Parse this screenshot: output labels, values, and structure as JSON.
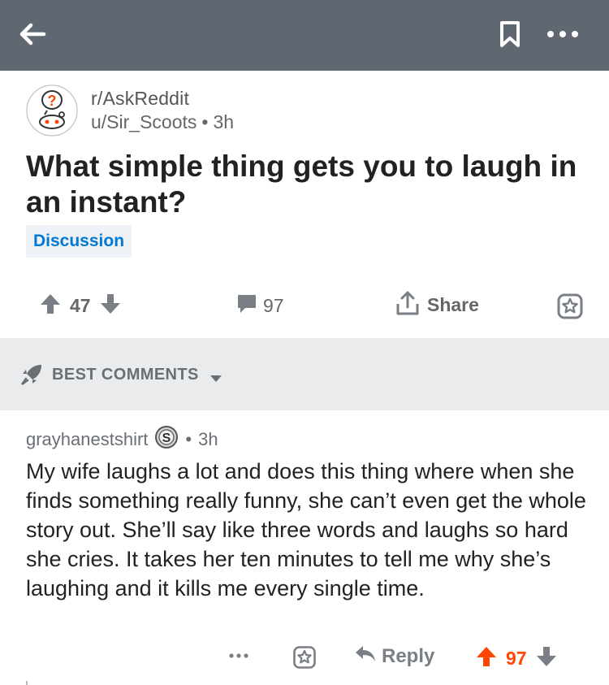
{
  "topbar": {
    "back_icon": "arrow-left-icon",
    "bookmark_icon": "bookmark-icon",
    "more_icon": "more-horizontal-icon",
    "color": "#5f6770"
  },
  "post": {
    "subreddit": "r/AskReddit",
    "author": "u/Sir_Scoots",
    "separator": "•",
    "age": "3h",
    "title": "What simple thing gets you to laugh in an instant?",
    "flair": "Discussion",
    "score": "47",
    "comments": "97",
    "share_label": "Share"
  },
  "sort": {
    "label": "BEST COMMENTS"
  },
  "comment": {
    "author": "grayhanestshirt",
    "separator": "•",
    "age": "3h",
    "body": "My wife laughs a lot and does this thing where when she finds something really funny, she can’t even get the whole story out. She’ll say like three words and laughs so hard she cries. It takes her ten minutes to tell me why she’s laughing and it kills me every single time.",
    "reply_label": "Reply",
    "score": "97",
    "score_color": "#ff4500",
    "award_icon": "silver-award-icon"
  }
}
